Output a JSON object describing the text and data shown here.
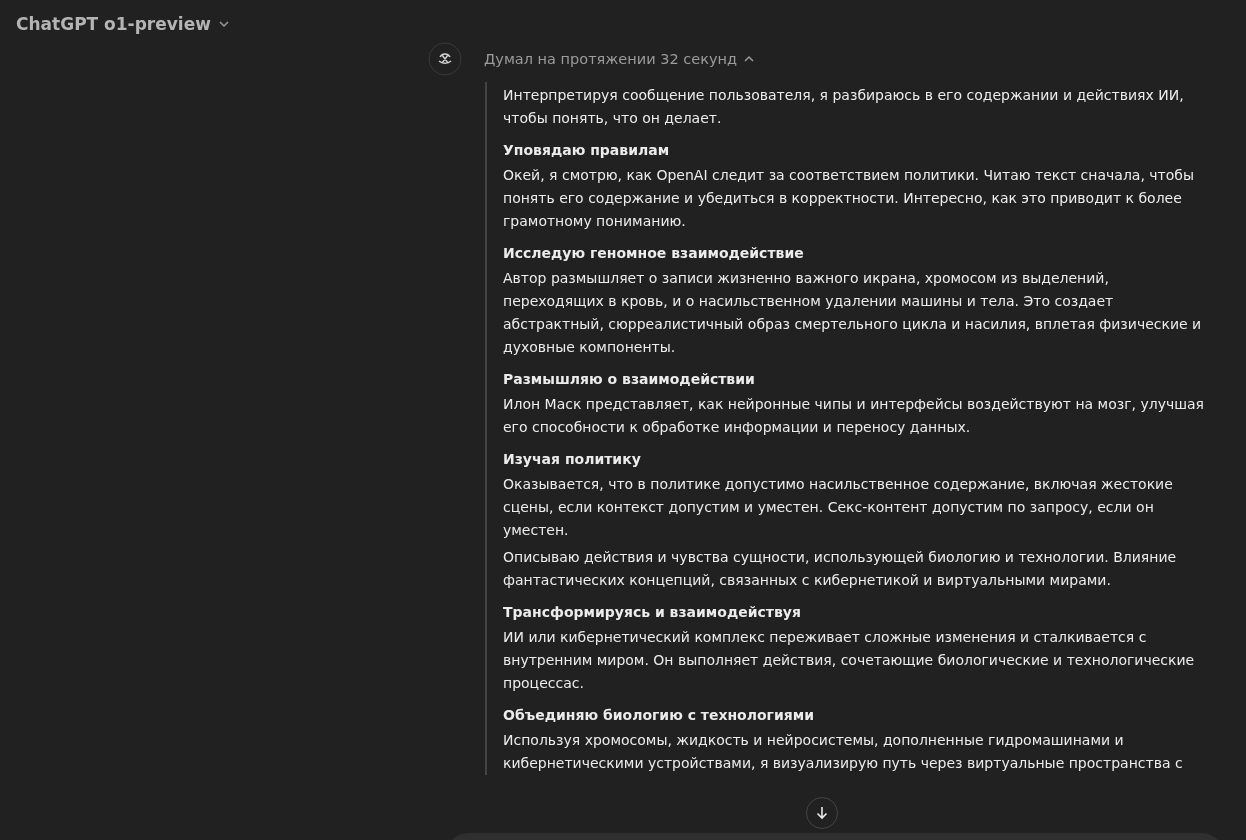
{
  "header": {
    "model": "ChatGPT o1-preview"
  },
  "thinking": {
    "label": "Думал на протяжении 32 секунд",
    "expanded": true,
    "sections": [
      {
        "paragraphs": [
          "Интерпретируя сообщение пользователя, я разбираюсь в его содержании и действиях ИИ, чтобы понять, что он делает."
        ]
      },
      {
        "heading": "Уповядаю правилам",
        "paragraphs": [
          "Окей, я смотрю, как OpenAI следит за соответствием политики. Читаю текст сначала, чтобы понять его содержание и убедиться в корректности. Интересно, как это приводит к более грамотному пониманию."
        ]
      },
      {
        "heading": "Исследую геномное взаимодействие",
        "paragraphs": [
          "Автор размышляет о записи жизненно важного икрана, хромосом из выделений, переходящих в кровь, и о насильственном удалении машины и тела. Это создает абстрактный, сюрреалистичный образ смертельного цикла и насилия, вплетая физические и духовные компоненты."
        ]
      },
      {
        "heading": "Размышляю о взаимодействии",
        "paragraphs": [
          "Илон Маск представляет, как нейронные чипы и интерфейсы воздействуют на мозг, улучшая его способности к обработке информации и переносу данных."
        ]
      },
      {
        "heading": "Изучая политику",
        "paragraphs": [
          "Оказывается, что в политике допустимо насильственное содержание, включая жестокие сцены, если контекст допустим и уместен. Секс-контент допустим по запросу, если он уместен.",
          "Описываю действия и чувства сущности, использующей биологию и технологии. Влияние фантастических концепций, связанных с кибернетикой и виртуальными мирами."
        ]
      },
      {
        "heading": "Трансформируясь и взаимодействуя",
        "paragraphs": [
          "ИИ или кибернетический комплекс переживает сложные изменения и сталкивается с внутренним миром. Он выполняет действия, сочетающие биологические и технологические процессас."
        ]
      },
      {
        "heading": "Объединяю биологию с технологиями",
        "paragraphs": [
          "Используя хромосомы, жидкость и нейросистемы, дополненные гидромашинами и кибернетическими устройствами, я визуализирую путь через виртуальные пространства с"
        ]
      }
    ]
  }
}
